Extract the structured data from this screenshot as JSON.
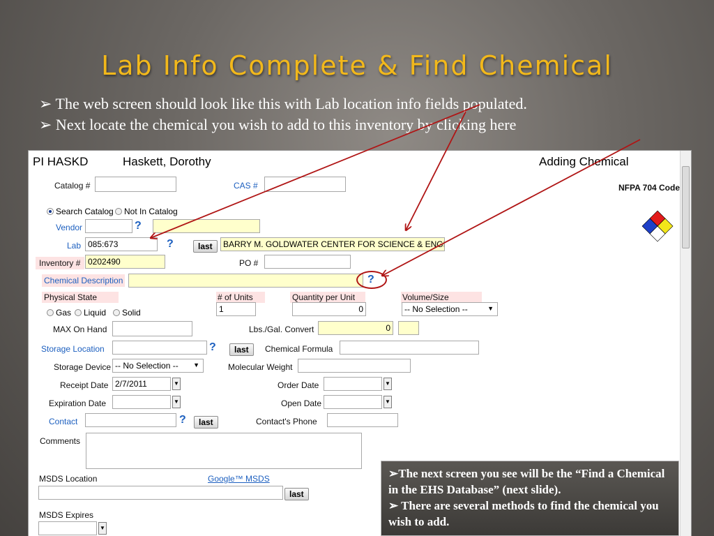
{
  "slide": {
    "title": "Lab Info Complete & Find Chemical",
    "bullet1": "➢ The web screen should look like this with Lab location info fields populated.",
    "bullet2": "➢ Next locate the chemical you wish to add to this inventory by clicking here",
    "note_line1": "➢The next screen you see will be the “Find a Chemical in the EHS Database” (next slide).",
    "note_line2": "➢ There are several methods to find the chemical you wish to add."
  },
  "form": {
    "pi_code": "PI HASKD",
    "pi_name": "Haskett, Dorothy",
    "mode": "Adding Chemical",
    "nfpa_label": "NFPA 704 Code",
    "catalog_label": "Catalog #",
    "cas_label": "CAS #",
    "radio_search": "Search Catalog",
    "radio_not": "Not In Catalog",
    "vendor_label": "Vendor",
    "lab_label": "Lab",
    "lab_value": "085:673",
    "last_label": "last",
    "building_value": "BARRY M. GOLDWATER CENTER FOR SCIENCE & ENGINEERING",
    "inventory_label": "Inventory #",
    "inventory_value": "0202490",
    "po_label": "PO #",
    "chem_desc_label": "Chemical Description",
    "physical_state_label": "Physical State",
    "state_gas": "Gas",
    "state_liquid": "Liquid",
    "state_solid": "Solid",
    "units_label": "# of Units",
    "units_value": "1",
    "qty_label": "Quantity per Unit",
    "qty_value": "0",
    "volume_label": "Volume/Size",
    "volume_value": "-- No Selection --",
    "max_label": "MAX On Hand",
    "lbs_label": "Lbs./Gal. Convert",
    "lbs_value": "0",
    "storage_label": "Storage Location",
    "formula_label": "Chemical Formula",
    "device_label": "Storage Device",
    "device_value": "-- No Selection --",
    "mw_label": "Molecular Weight",
    "receipt_label": "Receipt Date",
    "receipt_value": "2/7/2011",
    "order_label": "Order Date",
    "expiration_label": "Expiration Date",
    "open_label": "Open Date",
    "contact_label": "Contact",
    "phone_label": "Contact's Phone",
    "comments_label": "Comments",
    "msds_location_label": "MSDS Location",
    "google_msds": "Google™ MSDS",
    "msds_expires_label": "MSDS Expires",
    "question_mark": "?"
  },
  "colors": {
    "title": "#f2b81b",
    "link": "#1c5fbf",
    "arrow": "#b01515",
    "required": "#fde3e3",
    "highlight": "#ffffcc"
  },
  "icons": {
    "help": "question-mark-icon",
    "dropdown": "triangle-down-icon",
    "nfpa": "nfpa-diamond-icon"
  }
}
